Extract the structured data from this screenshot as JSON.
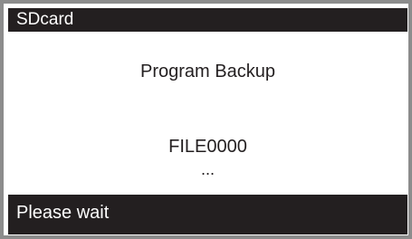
{
  "title_bar": {
    "label": "SDcard"
  },
  "main": {
    "heading": "Program Backup",
    "filename": "FILE0000",
    "ellipsis": "..."
  },
  "status_bar": {
    "message": "Please wait"
  },
  "colors": {
    "frame": "#8c8c8c",
    "bar_background": "#231f20",
    "bar_text": "#ffffff",
    "body_background": "#ffffff",
    "body_text": "#231f20"
  }
}
